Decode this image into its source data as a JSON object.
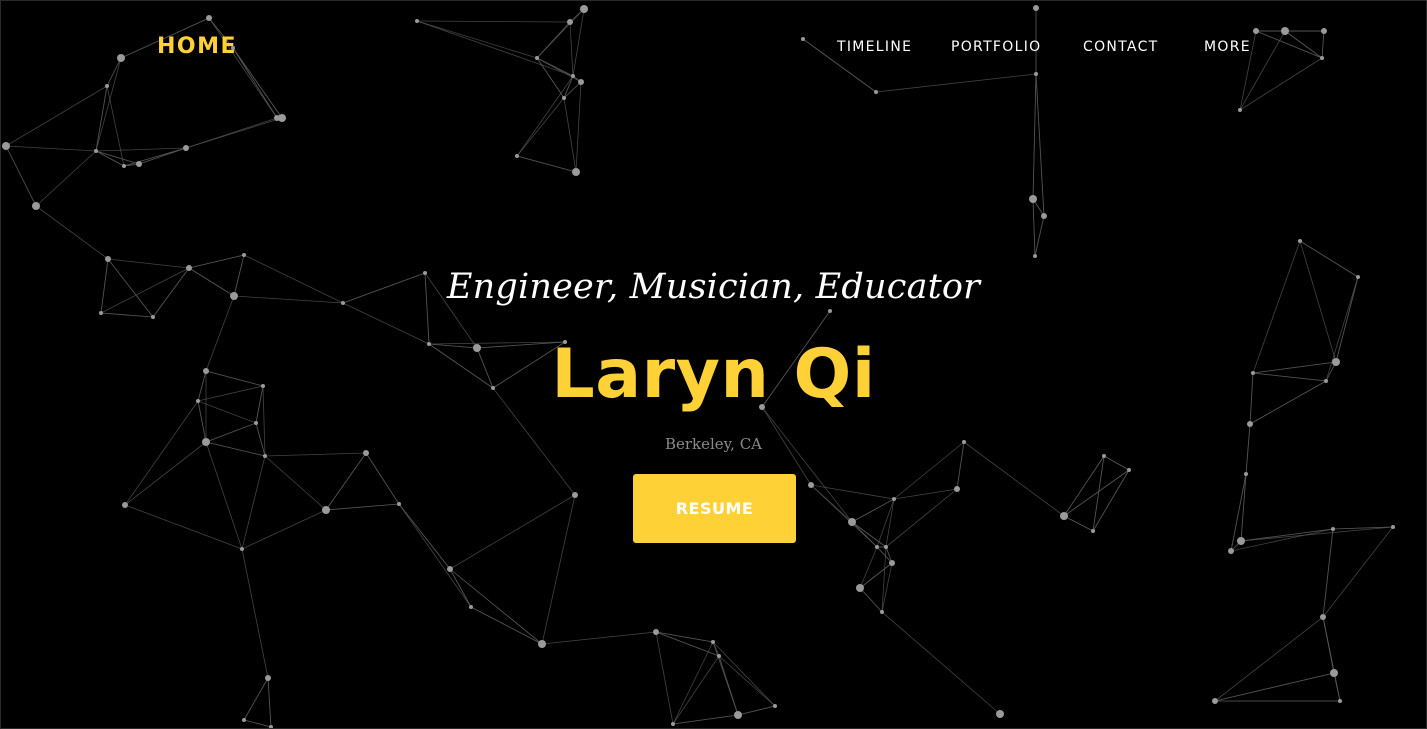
{
  "nav": {
    "brand": "HOME",
    "links": [
      "TIMELINE",
      "PORTFOLIO",
      "CONTACT",
      "MORE"
    ]
  },
  "hero": {
    "subtitle": "Engineer, Musician, Educator",
    "name": "Laryn Qi",
    "location": "Berkeley, CA",
    "button_label": "RESUME"
  },
  "colors": {
    "accent": "#fed136",
    "background": "#000000",
    "nav_text": "#ffffff",
    "muted_text": "#8a8a8a",
    "particle": "#9a9a9a"
  }
}
